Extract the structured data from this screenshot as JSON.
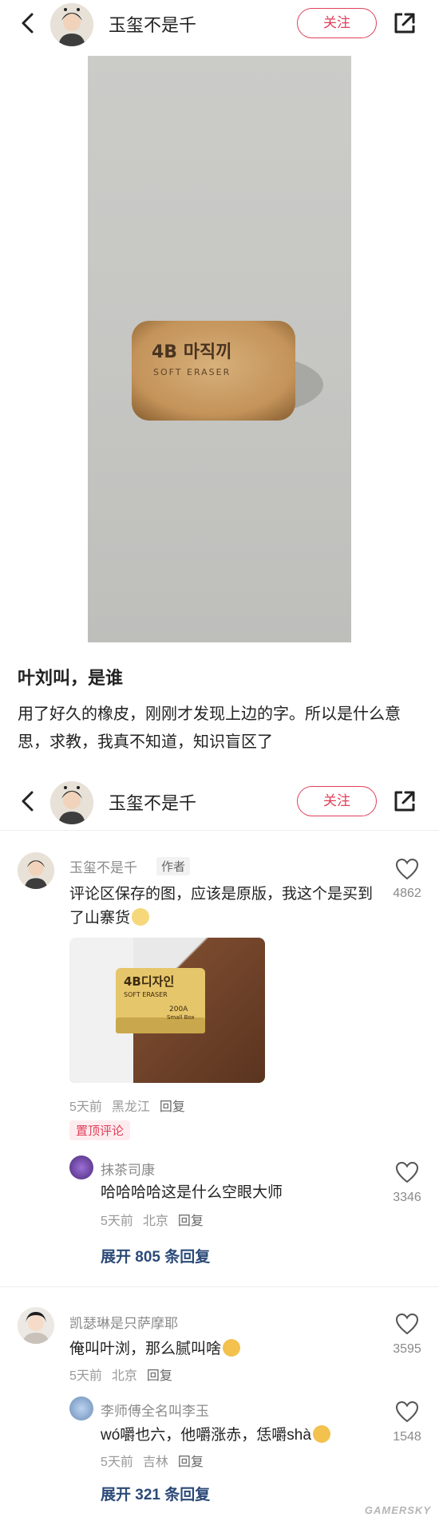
{
  "header": {
    "username": "玉玺不是千",
    "follow_label": "关注"
  },
  "photo": {
    "eraser_brand": "4B 마직끼",
    "eraser_sub": "SOFT ERASER"
  },
  "post": {
    "title": "叶刘叫，是谁",
    "body": "用了好久的橡皮，刚刚才发现上边的字。所以是什么意思，求教，我真不知道，知识盲区了"
  },
  "comments": [
    {
      "user": "玉玺不是千",
      "tag": "作者",
      "text": "评论区保存的图，应该是原版，我这个是买到了山寨货",
      "image": {
        "brand": "4B디자인",
        "sub": "SOFT ERASER",
        "model": "200A",
        "note": "Small Box"
      },
      "time": "5天前",
      "location": "黑龙江",
      "reply_label": "回复",
      "pin_label": "置顶评论",
      "likes": "4862",
      "replies": [
        {
          "user": "抹茶司康",
          "text": "哈哈哈哈这是什么空眼大师",
          "time": "5天前",
          "location": "北京",
          "reply_label": "回复",
          "likes": "3346"
        }
      ],
      "expand_label": "展开 805 条回复"
    },
    {
      "user": "凯瑟琳是只萨摩耶",
      "text": "俺叫叶浏，那么腻叫啥",
      "time": "5天前",
      "location": "北京",
      "reply_label": "回复",
      "likes": "3595",
      "replies": [
        {
          "user": "李师傅全名叫李玉",
          "text": "wó嚼也六，他嚼涨赤，恁嚼shà",
          "time": "5天前",
          "location": "吉林",
          "reply_label": "回复",
          "likes": "1548"
        }
      ],
      "expand_label": "展开 321 条回复"
    }
  ],
  "watermark": "GAMERSKY",
  "colors": {
    "accent": "#e0405a",
    "link": "#2c4a78",
    "meta": "#999999"
  }
}
